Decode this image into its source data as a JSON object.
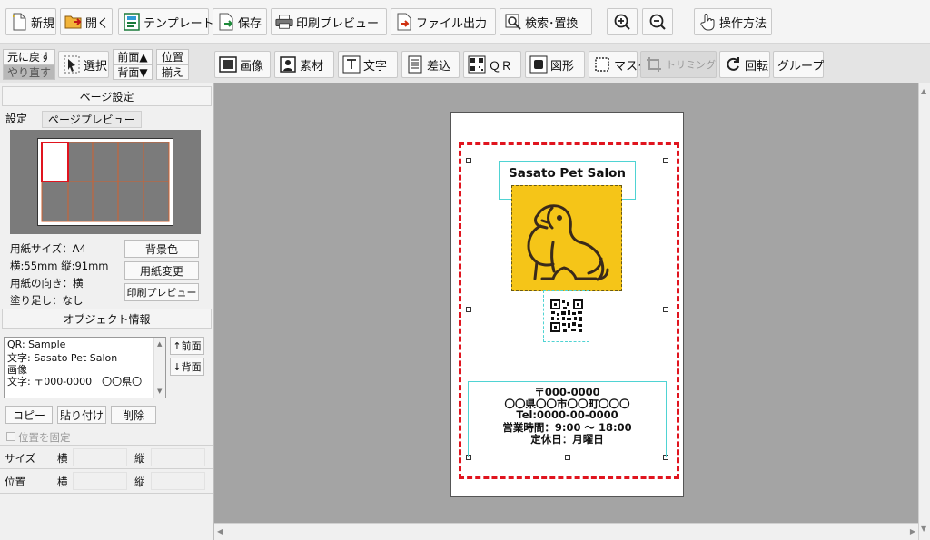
{
  "toolbar_top": {
    "new": "新規",
    "open": "開く",
    "template": "テンプレート",
    "save": "保存",
    "print_preview": "印刷プレビュー",
    "file_output": "ファイル出力",
    "search_replace": "検索･置換",
    "how_to": "操作方法"
  },
  "toolbar_second": {
    "undo": "元に戻す",
    "redo": "やり直す",
    "select": "選択",
    "front": "前面▲",
    "back": "背面▼",
    "align_1": "位置",
    "align_2": "揃え",
    "image": "画像",
    "material": "素材",
    "text": "文字",
    "merge": "差込",
    "qr": "ＱＲ",
    "shape": "図形",
    "mask": "マスク",
    "trimming": "トリミング",
    "rotate": "回転",
    "group": "グループ"
  },
  "page_settings": {
    "title": "ページ設定",
    "tab_settings": "設定",
    "tab_preview": "ページプレビュー",
    "paper_size": "用紙サイズ：A4",
    "dimensions": "横:55mm 縦:91mm",
    "orientation": "用紙の向き：横",
    "bleed": "塗り足し：なし",
    "bg_color_button": "背景色",
    "change_paper_button": "用紙変更",
    "print_preview_button": "印刷プレビュー"
  },
  "object_info": {
    "title": "オブジェクト情報",
    "items": [
      "QR: Sample",
      "文字: Sasato Pet Salon",
      "画像",
      "文字: 〒000-0000　〇〇県〇"
    ],
    "front_button": "↑前面",
    "back_button": "↓背面",
    "copy_button": "コピー",
    "paste_button": "貼り付け",
    "delete_button": "削除",
    "lock_position": "位置を固定",
    "size_label": "サイズ",
    "position_label": "位置",
    "width_label": "横",
    "height_label": "縦"
  },
  "card": {
    "title": "Sasato Pet Salon",
    "lines": [
      "〒000-0000",
      "〇〇県〇〇市〇〇町〇〇〇",
      "Tel:0000-00-0000",
      "営業時間：9:00 ～ 18:00",
      "定休日：月曜日"
    ]
  },
  "colors": {
    "accent_red": "#e0141e",
    "logo_yellow": "#f5c518",
    "logo_line": "#3a2a1a",
    "canvas_bg": "#a4a4a4",
    "selection": "#4fd3d3"
  }
}
